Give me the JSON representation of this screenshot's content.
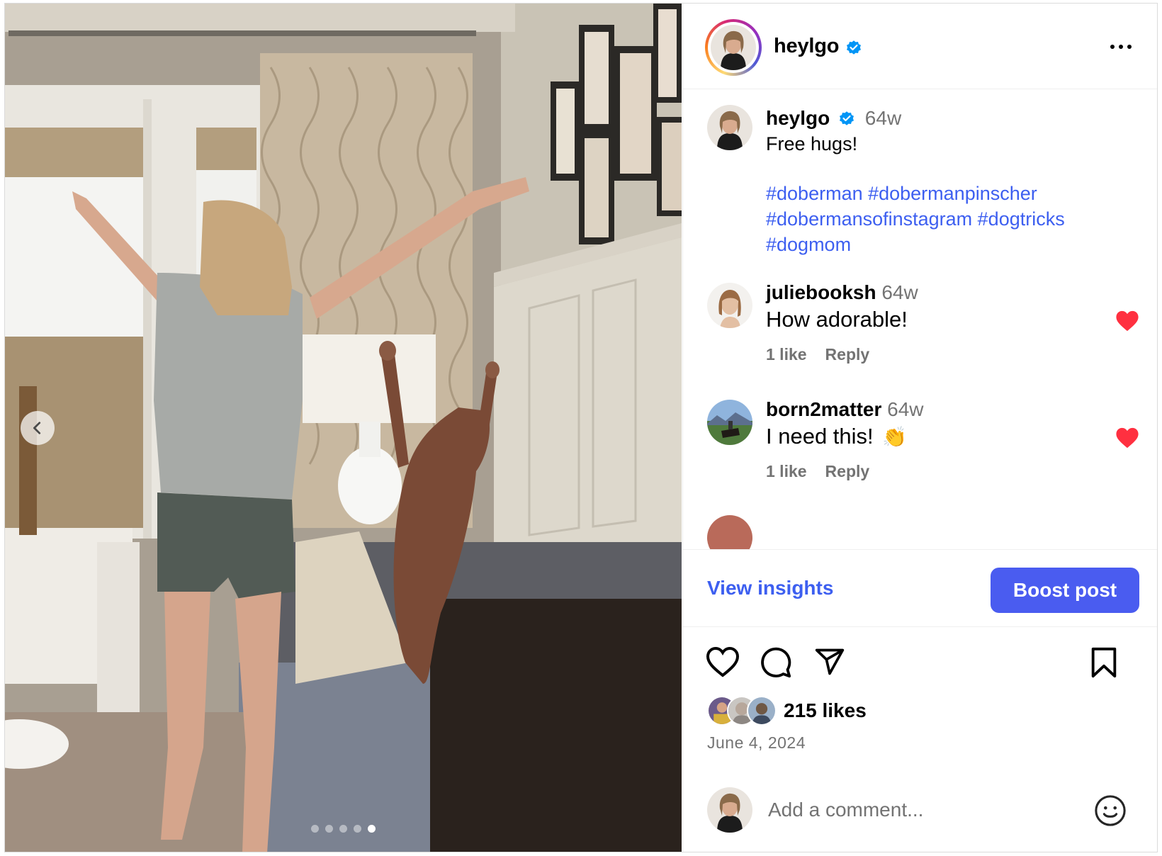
{
  "post": {
    "author": "heylgo",
    "verified": true,
    "more_label": "More options",
    "carousel": {
      "slides": 5,
      "active_index": 4
    }
  },
  "caption": {
    "username": "heylgo",
    "time": "64w",
    "text": "Free hugs!",
    "hashtags": [
      "#doberman #dobermanpinscher",
      "#dobermansofinstagram #dogtricks",
      "#dogmom"
    ]
  },
  "comments": [
    {
      "username": "juliebooksh",
      "time": "64w",
      "text": "How adorable!",
      "likes": "1 like",
      "reply": "Reply",
      "liked": true
    },
    {
      "username": "born2matter",
      "time": "64w",
      "text": "I need this!",
      "emoji": "👏",
      "likes": "1 like",
      "reply": "Reply",
      "liked": true
    }
  ],
  "insights": {
    "view_label": "View insights",
    "boost_label": "Boost post"
  },
  "engagement": {
    "likes": "215 likes",
    "date": "June 4, 2024"
  },
  "add_comment": {
    "placeholder": "Add a comment..."
  },
  "colors": {
    "link": "#3d5ff0",
    "boost": "#4a5cf0",
    "heart": "#ff3040",
    "muted": "#737373"
  },
  "icons": [
    "chevron-left-icon",
    "verified-badge-icon",
    "more-icon",
    "heart-icon",
    "comment-icon",
    "share-icon",
    "bookmark-icon",
    "emoji-icon"
  ]
}
